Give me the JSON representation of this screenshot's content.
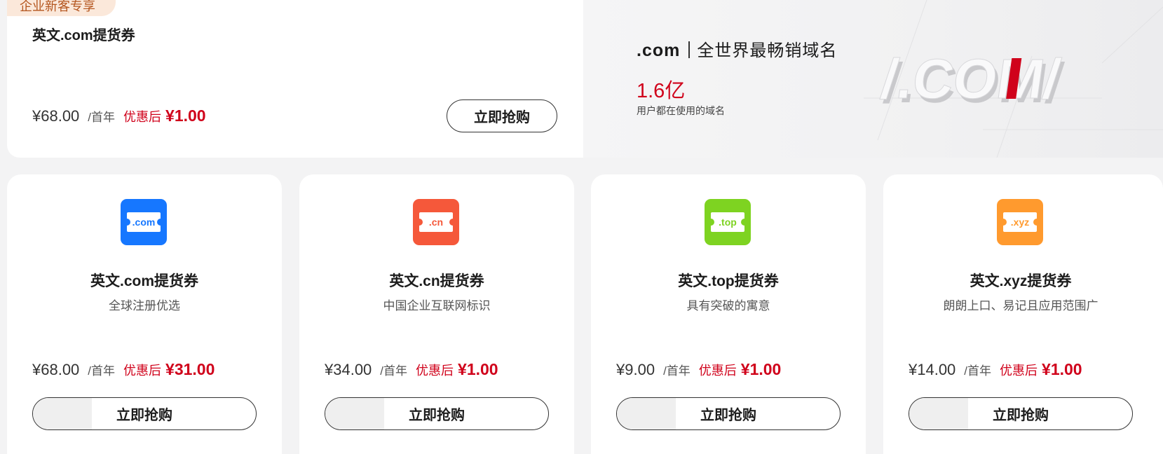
{
  "top": {
    "badge": "企业新客专享",
    "title": "英文.com提货券",
    "price": "¥68.00",
    "unit": "/首年",
    "after_label": "优惠后",
    "after_price": "¥1.00",
    "button": "立即抢购"
  },
  "hero": {
    "title_main": ".com",
    "title_sub": "全世界最畅销域名",
    "stat": "1.6亿",
    "desc": "用户都在使用的域名",
    "art_text": "/.COM/"
  },
  "cards": [
    {
      "icon": "com-ticket-icon",
      "icon_text": ".com",
      "color": "#1677ff",
      "name": "英文.com提货券",
      "desc": "全球注册优选",
      "price": "¥68.00",
      "unit": "/首年",
      "after_label": "优惠后",
      "after_price": "¥31.00",
      "button": "立即抢购"
    },
    {
      "icon": "cn-ticket-icon",
      "icon_text": ".cn",
      "color": "#f5583a",
      "name": "英文.cn提货券",
      "desc": "中国企业互联网标识",
      "price": "¥34.00",
      "unit": "/首年",
      "after_label": "优惠后",
      "after_price": "¥1.00",
      "button": "立即抢购"
    },
    {
      "icon": "top-ticket-icon",
      "icon_text": ".top",
      "color": "#7ed321",
      "name": "英文.top提货券",
      "desc": "具有突破的寓意",
      "price": "¥9.00",
      "unit": "/首年",
      "after_label": "优惠后",
      "after_price": "¥1.00",
      "button": "立即抢购"
    },
    {
      "icon": "xyz-ticket-icon",
      "icon_text": ".xyz",
      "color": "#ff9a2e",
      "name": "英文.xyz提货券",
      "desc": "朗朗上口、易记且应用范围广",
      "price": "¥14.00",
      "unit": "/首年",
      "after_label": "优惠后",
      "after_price": "¥1.00",
      "button": "立即抢购"
    }
  ]
}
